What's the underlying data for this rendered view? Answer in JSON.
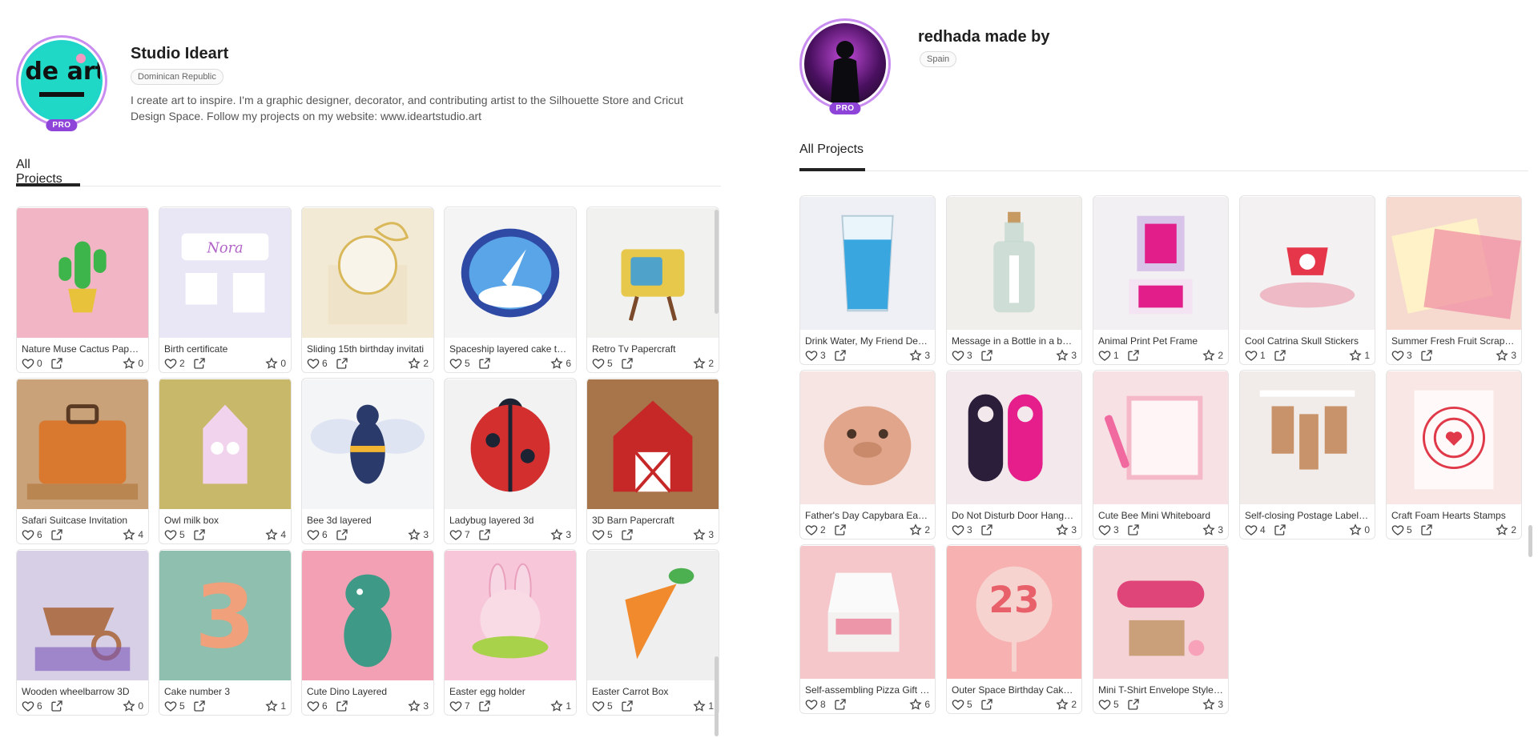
{
  "left": {
    "name": "Studio Ideart",
    "country": "Dominican Republic",
    "bio": "I create art to inspire. I'm a graphic designer, decorator, and contributing artist to the Silhouette Store and Cricut Design Space. Follow my projects on my website: www.ideartstudio.art",
    "pro": "PRO",
    "avatar_text": "ide art",
    "tab": "All Projects",
    "projects": [
      {
        "title": "Nature Muse Cactus Paperc...",
        "likes": "0",
        "favs": "0",
        "bg": "#f2b5c6",
        "fg": "#3db54a",
        "icon": "cactus-icon"
      },
      {
        "title": "Birth certificate",
        "likes": "2",
        "favs": "0",
        "bg": "#e9e6f5",
        "fg": "#b18de0",
        "icon": "certificate-icon"
      },
      {
        "title": "Sliding 15th birthday invitati",
        "likes": "6",
        "favs": "2",
        "bg": "#f3ead6",
        "fg": "#d9b85a",
        "icon": "invitation-icon"
      },
      {
        "title": "Spaceship layered cake top...",
        "likes": "5",
        "favs": "6",
        "bg": "#f4f4f4",
        "fg": "#2f4aa8",
        "icon": "rocket-icon"
      },
      {
        "title": "Retro Tv Papercraft",
        "likes": "5",
        "favs": "2",
        "bg": "#f1f1ef",
        "fg": "#e8c84a",
        "icon": "tv-icon"
      },
      {
        "title": "Safari Suitcase Invitation",
        "likes": "6",
        "favs": "4",
        "bg": "#c9a27a",
        "fg": "#d9792f",
        "icon": "suitcase-icon"
      },
      {
        "title": "Owl milk box",
        "likes": "5",
        "favs": "4",
        "bg": "#c8b86a",
        "fg": "#f1d3ee",
        "icon": "milk-box-icon"
      },
      {
        "title": "Bee 3d layered",
        "likes": "6",
        "favs": "3",
        "bg": "#f4f5f7",
        "fg": "#2a3a6a",
        "icon": "bee-icon"
      },
      {
        "title": "Ladybug layered 3d",
        "likes": "7",
        "favs": "3",
        "bg": "#f2f2f2",
        "fg": "#d32f2f",
        "icon": "ladybug-icon"
      },
      {
        "title": "3D Barn Papercraft",
        "likes": "5",
        "favs": "3",
        "bg": "#a8744a",
        "fg": "#c62828",
        "icon": "barn-icon"
      },
      {
        "title": "Wooden wheelbarrow 3D",
        "likes": "6",
        "favs": "0",
        "bg": "#d7cfe6",
        "fg": "#b07350",
        "icon": "wheelbarrow-icon"
      },
      {
        "title": "Cake number 3",
        "likes": "5",
        "favs": "1",
        "bg": "#8fbfae",
        "fg": "#f0a07a",
        "icon": "number-three-icon"
      },
      {
        "title": "Cute Dino Layered",
        "likes": "6",
        "favs": "3",
        "bg": "#f3a0b5",
        "fg": "#3e9a86",
        "icon": "dino-icon"
      },
      {
        "title": "Easter egg holder",
        "likes": "7",
        "favs": "1",
        "bg": "#f7c6d8",
        "fg": "#f4b6cc",
        "icon": "bunny-icon"
      },
      {
        "title": "Easter Carrot Box",
        "likes": "5",
        "favs": "1",
        "bg": "#efefef",
        "fg": "#f08a2c",
        "icon": "carrot-icon"
      }
    ]
  },
  "right": {
    "name": "redhada made by",
    "country": "Spain",
    "pro": "PRO",
    "tab": "All Projects",
    "projects": [
      {
        "title": "Drink Water, My Friend Decal",
        "likes": "3",
        "favs": "3",
        "bg": "#eef0f6",
        "fg": "#3aa6e0",
        "icon": "glass-icon"
      },
      {
        "title": "Message in a Bottle in a bot...",
        "likes": "3",
        "favs": "3",
        "bg": "#f1efec",
        "fg": "#b8d2c8",
        "icon": "bottle-icon"
      },
      {
        "title": "Animal Print Pet Frame",
        "likes": "1",
        "favs": "2",
        "bg": "#f2f0f2",
        "fg": "#e21e8a",
        "icon": "frame-icon"
      },
      {
        "title": "Cool Catrina Skull Stickers",
        "likes": "1",
        "favs": "1",
        "bg": "#f3f1f1",
        "fg": "#e5364a",
        "icon": "skull-icon"
      },
      {
        "title": "Summer Fresh Fruit Scrap P...",
        "likes": "3",
        "favs": "3",
        "bg": "#f6d9cf",
        "fg": "#f08aa0",
        "icon": "paper-icon"
      },
      {
        "title": "Father's Day Capybara Easel",
        "likes": "2",
        "favs": "2",
        "bg": "#f6e5e3",
        "fg": "#e0a58a",
        "icon": "capybara-icon"
      },
      {
        "title": "Do Not Disturb Door Hange...",
        "likes": "3",
        "favs": "3",
        "bg": "#f3e9ec",
        "fg": "#2b1e3a",
        "icon": "door-hanger-icon"
      },
      {
        "title": "Cute Bee Mini Whiteboard",
        "likes": "3",
        "favs": "3",
        "bg": "#f7e1e4",
        "fg": "#f4b8c8",
        "icon": "whiteboard-icon"
      },
      {
        "title": "Self-closing Postage Label T...",
        "likes": "4",
        "favs": "0",
        "bg": "#f1ecea",
        "fg": "#c8936a",
        "icon": "tag-icon"
      },
      {
        "title": "Craft Foam Hearts Stamps",
        "likes": "5",
        "favs": "2",
        "bg": "#f8e7e5",
        "fg": "#e03a4a",
        "icon": "heart-stamp-icon"
      },
      {
        "title": "Self-assembling Pizza Gift B...",
        "likes": "8",
        "favs": "6",
        "bg": "#f5c7cb",
        "fg": "#f0f0f0",
        "icon": "pizza-box-icon"
      },
      {
        "title": "Outer Space Birthday Cake ...",
        "likes": "5",
        "favs": "2",
        "bg": "#f6b1b0",
        "fg": "#f7d3d0",
        "icon": "cake-topper-icon"
      },
      {
        "title": "Mini T-Shirt Envelope Style ...",
        "likes": "5",
        "favs": "3",
        "bg": "#f5d2d6",
        "fg": "#e0457a",
        "icon": "envelope-icon"
      }
    ]
  }
}
